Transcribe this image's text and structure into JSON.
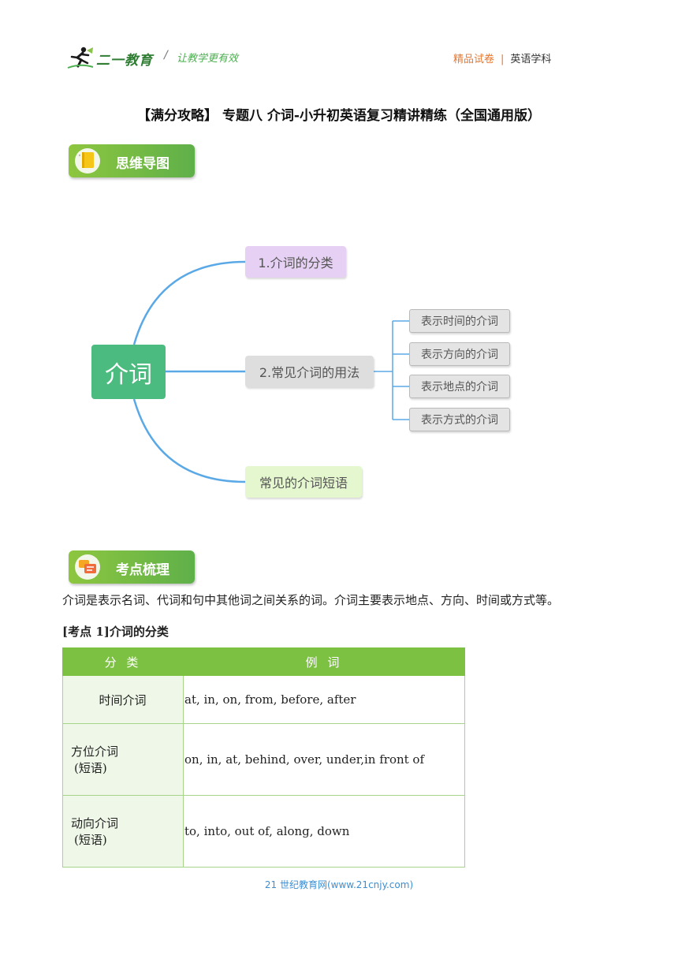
{
  "header": {
    "logo_text": "二一教育",
    "slogan": "让教学更有效",
    "tag_primary": "精品试卷",
    "tag_subject": "英语学科"
  },
  "document": {
    "title": "【满分攻略】 专题八  介词-小升初英语复习精讲精练（全国通用版）"
  },
  "sections": {
    "mindmap_banner": "思维导图",
    "points_banner": "考点梳理"
  },
  "mindmap": {
    "root": "介词",
    "branches": [
      {
        "label": "1.介词的分类"
      },
      {
        "label": "2.常见介词的用法",
        "children": [
          "表示时间的介词",
          "表示方向的介词",
          "表示地点的介词",
          "表示方式的介词"
        ]
      },
      {
        "label": "常见的介词短语"
      }
    ]
  },
  "intro_text": "介词是表示名词、代词和句中其他词之间关系的词。介词主要表示地点、方向、时间或方式等。",
  "kaodian1": {
    "title": "[考点 1]介词的分类",
    "headers": [
      "分 类",
      "例 词"
    ],
    "rows": [
      {
        "category": "时间介词",
        "category_note": "",
        "examples": "at, in, on, from, before, after"
      },
      {
        "category": "方位介词",
        "category_note": "(短语)",
        "examples": "on, in, at, behind, over, under,in front of"
      },
      {
        "category": "动向介词",
        "category_note": "(短语)",
        "examples": "to, into, out of, along, down"
      }
    ]
  },
  "footer": "21 世纪教育网(www.21cnjy.com)",
  "colors": {
    "brand_green": "#4cbb7f",
    "table_header": "#7cc142",
    "accent_orange": "#e8772e",
    "connector_blue": "#5aa9e6"
  }
}
